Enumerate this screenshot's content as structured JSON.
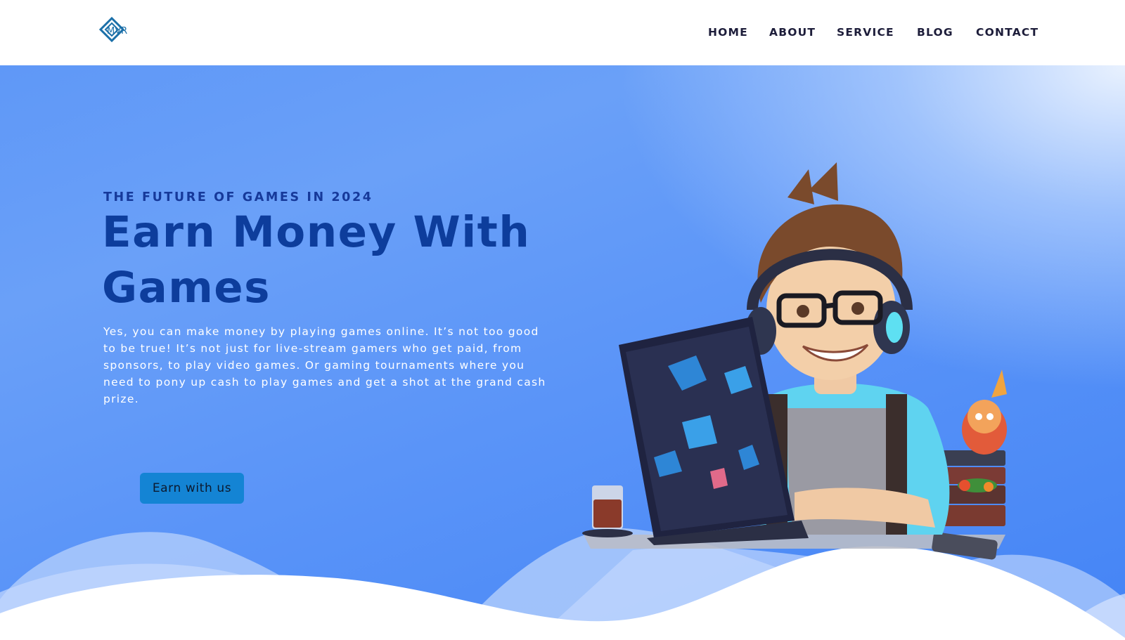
{
  "header": {
    "logo_text": "MVR",
    "nav": [
      {
        "label": "HOME"
      },
      {
        "label": "ABOUT"
      },
      {
        "label": "SERVICE"
      },
      {
        "label": "BLOG"
      },
      {
        "label": "CONTACT"
      }
    ]
  },
  "hero": {
    "eyebrow": "THE FUTURE OF GAMES IN 2024",
    "title": "Earn Money With Games",
    "description": "Yes, you can make money by playing games online. It’s not too good to be true! It’s not just for live-stream gamers who get paid, from sponsors, to play video games. Or gaming tournaments where you need to pony up cash to play games and get a shot at the grand cash prize.",
    "cta_label": "Earn with us"
  },
  "colors": {
    "accent": "#1484d4",
    "heading": "#0d3d9c",
    "nav_text": "#1d1d3a",
    "logo": "#1a6fa8",
    "hero_blue": "#4484f5"
  },
  "icons": {
    "logo": "mvr-diamond-logo",
    "illustration": "gamer-with-laptop-illustration"
  }
}
